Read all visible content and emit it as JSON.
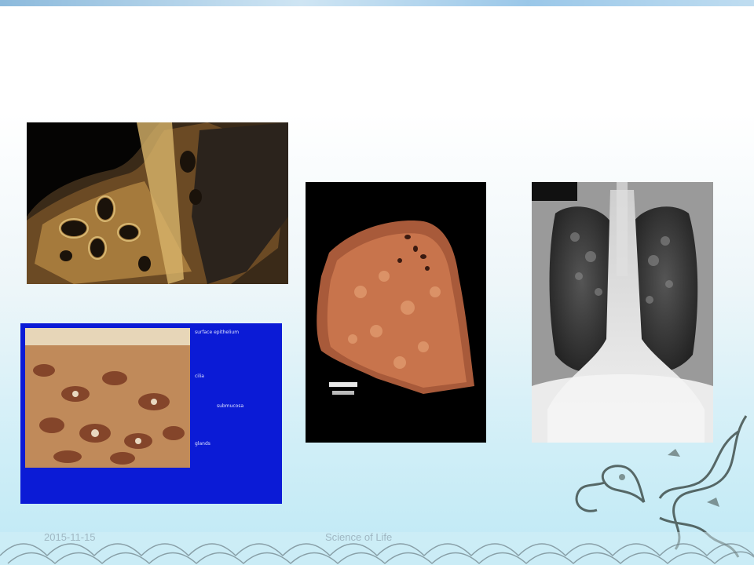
{
  "slide": {
    "footer": {
      "date": "2015-11-15",
      "center": "Science of Life",
      "page": ""
    },
    "histology": {
      "labels": {
        "surface": "surface epithelium",
        "cilia": "cilia",
        "submucosa": "submucosa",
        "glands": "glands"
      },
      "caption": ""
    },
    "colors": {
      "accent": "#7fb2d8",
      "histo_bg": "#0b1bd6"
    }
  }
}
